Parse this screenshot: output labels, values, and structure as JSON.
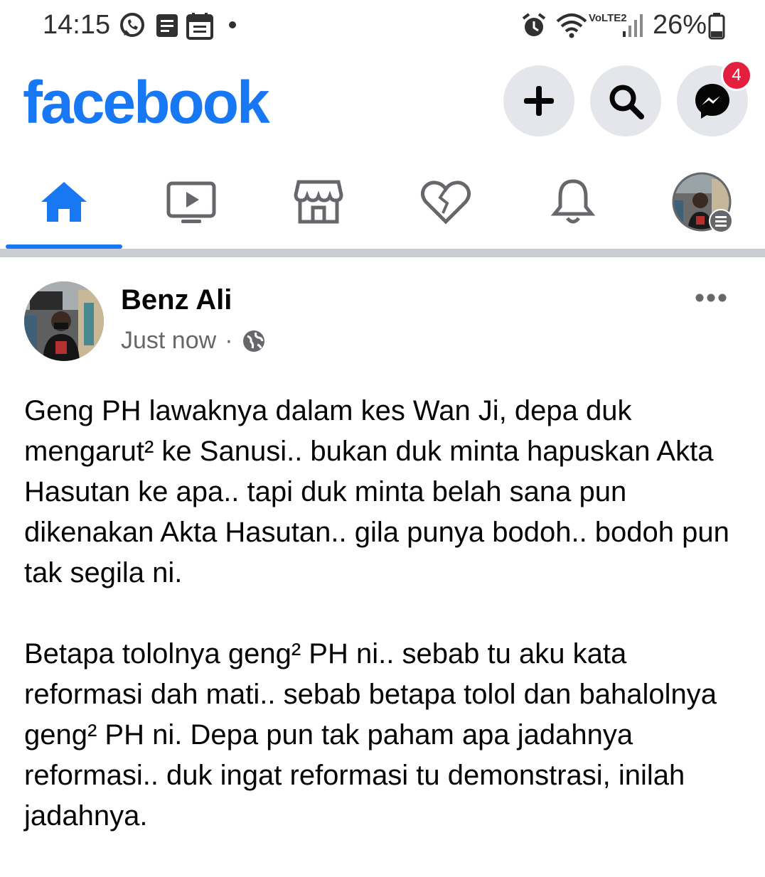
{
  "status_bar": {
    "time": "14:15",
    "notification_icons": [
      "whatsapp-icon",
      "message-icon",
      "calendar-icon",
      "dot-icon"
    ],
    "network_label": "VoLTE2",
    "battery": "26%"
  },
  "header": {
    "logo": "facebook",
    "actions": [
      "create-icon",
      "search-icon",
      "messenger-icon"
    ],
    "messenger_badge": "4",
    "brand_color": "#1877f2"
  },
  "nav": {
    "tabs": [
      "home",
      "watch",
      "marketplace",
      "dating",
      "notifications",
      "menu"
    ],
    "active": "home"
  },
  "post": {
    "author": "Benz Ali",
    "time": "Just now",
    "separator": "·",
    "privacy": "globe-icon",
    "paragraphs": [
      "Geng PH lawaknya dalam kes Wan Ji, depa duk mengarut² ke Sanusi.. bukan duk minta hapuskan Akta Hasutan ke apa.. tapi duk minta belah sana pun dikenakan Akta Hasutan.. gila punya bodoh.. bodoh pun tak segila ni.",
      "Betapa tololnya geng² PH ni.. sebab tu aku kata reformasi dah mati.. sebab betapa tolol dan bahalolnya geng² PH ni. Depa pun tak paham apa jadahnya reformasi.. duk ingat reformasi tu demonstrasi, inilah jadahnya."
    ]
  }
}
